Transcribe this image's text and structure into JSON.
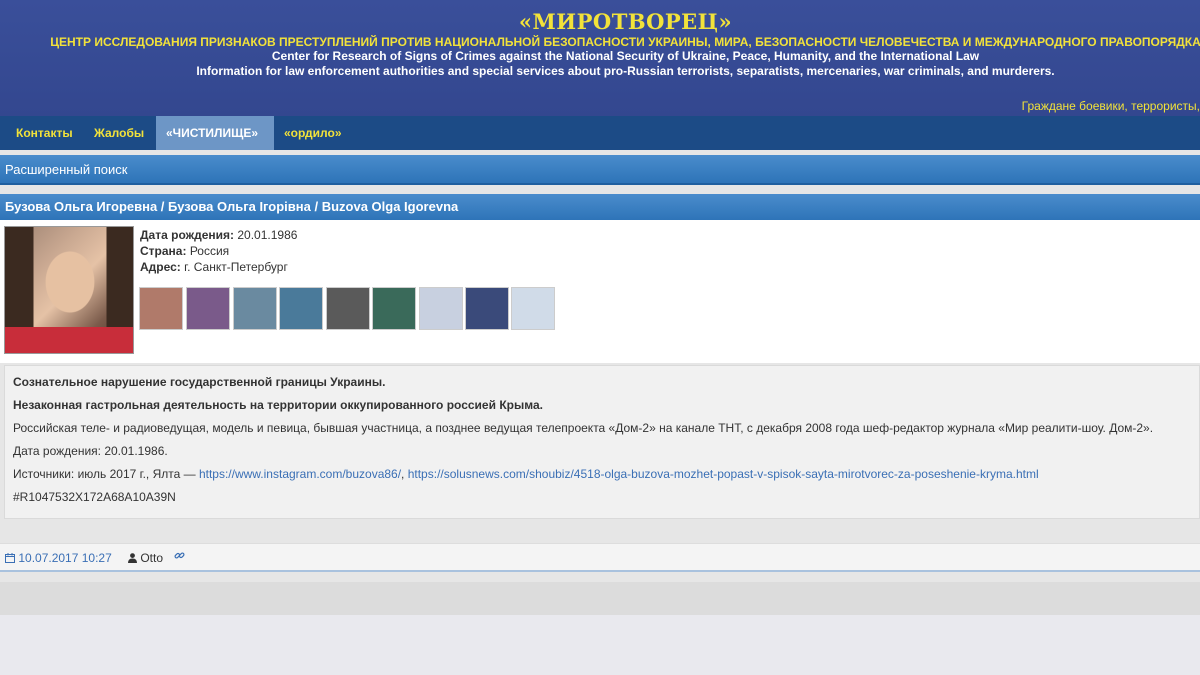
{
  "header": {
    "title": "«МИРОТВОРЕЦ»",
    "subtitle_ru": "ЦЕНТР ИССЛЕДОВАНИЯ ПРИЗНАКОВ ПРЕСТУПЛЕНИЙ ПРОТИВ НАЦИОНАЛЬНОЙ БЕЗОПАСНОСТИ УКРАИНЫ, МИРА, БЕЗОПАСНОСТИ ЧЕЛОВЕЧЕСТВА И МЕЖДУНАРОДНОГО ПРАВОПОРЯДКА",
    "subtitle_en1": "Center for Research of Signs of Crimes against the National Security of Ukraine, Peace, Humanity, and the International Law",
    "subtitle_en2": "Information for law enforcement authorities and special services about pro-Russian terrorists, separatists, mercenaries, war criminals, and murderers.",
    "marquee": "Граждане боевики, террористы,"
  },
  "nav": {
    "items": [
      {
        "label": "Контакты"
      },
      {
        "label": "Жалобы"
      },
      {
        "label": "«ЧИСТИЛИЩЕ»"
      },
      {
        "label": "«ордило»"
      }
    ]
  },
  "search": {
    "label": "Расширенный поиск"
  },
  "record": {
    "title": "Бузова Ольга Игоревна / Бузова Ольга Ігорівна / Buzova Olga Igorevna",
    "birth_label": "Дата рождения:",
    "birth_value": "20.01.1986",
    "country_label": "Страна:",
    "country_value": "Россия",
    "address_label": "Адрес:",
    "address_value": "г. Санкт-Петербург",
    "thumbnails": [
      {
        "color": "#b07a6a"
      },
      {
        "color": "#7a5a8a"
      },
      {
        "color": "#6a8aa0"
      },
      {
        "color": "#4a7a9a"
      },
      {
        "color": "#5a5a5a"
      },
      {
        "color": "#3a6a5a"
      },
      {
        "color": "#c8d0e0"
      },
      {
        "color": "#3a4a7a"
      },
      {
        "color": "#d0dbe8"
      }
    ]
  },
  "description": {
    "line1": "Сознательное нарушение государственной границы Украины.",
    "line2": "Незаконная гастрольная деятельность на территории оккупированного россией Крыма.",
    "line3": "Российская теле- и радиоведущая, модель и певица, бывшая участница, а позднее ведущая телепроекта «Дом-2» на канале ТНТ, с декабря 2008 года шеф-редактор журнала «Мир реалити-шоу. Дом-2».",
    "line4": "Дата рождения: 20.01.1986.",
    "sources_prefix": "Источники: июль 2017 г., Ялта — ",
    "source1": "https://www.instagram.com/buzova86/",
    "sep": ", ",
    "source2": "https://solusnews.com/shoubiz/4518-olga-buzova-mozhet-popast-v-spisok-sayta-mirotvorec-za-poseshenie-kryma.html",
    "hash": "#R1047532X172A68A10A39N"
  },
  "meta": {
    "date": "10.07.2017 10:27",
    "author": "Otto"
  }
}
